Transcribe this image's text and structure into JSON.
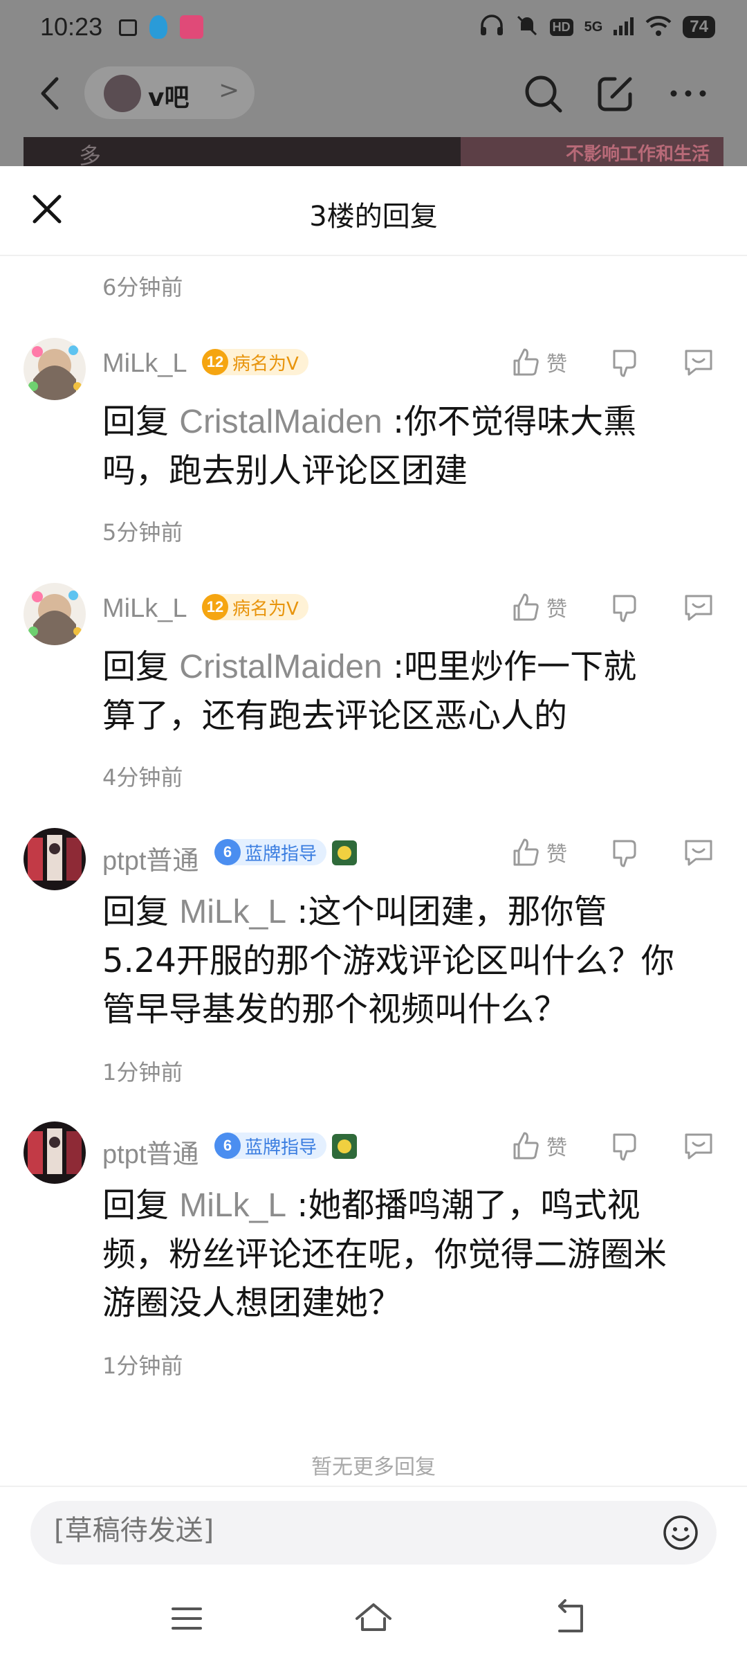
{
  "status_bar": {
    "time": "10:23",
    "network": "5G",
    "battery": "74"
  },
  "top_nav": {
    "forum_name": "v吧",
    "forum_arrow": ">"
  },
  "background_strip": {
    "left_text": "多",
    "right_text": "不影响工作和生活"
  },
  "sheet": {
    "title": "3楼的回复",
    "first_time": "6分钟前",
    "no_more": "暂无更多回复"
  },
  "replies": [
    {
      "username": "MiLk_L",
      "level": "12",
      "badge": "病名为V",
      "like_label": "赞",
      "prefix": "回复",
      "target": "CristalMaiden",
      "text_lines": [
        ":你不觉得味大熏",
        "吗，跑去别人评论区团建"
      ],
      "time": "5分钟前"
    },
    {
      "username": "MiLk_L",
      "level": "12",
      "badge": "病名为V",
      "like_label": "赞",
      "prefix": "回复",
      "target": "CristalMaiden",
      "text_lines": [
        ":吧里炒作一下就",
        "算了，还有跑去评论区恶心人的"
      ],
      "time": "4分钟前"
    },
    {
      "username": "ptpt普通",
      "level": "6",
      "badge": "蓝牌指导",
      "like_label": "赞",
      "prefix": "回复",
      "target": "MiLk_L",
      "text_lines": [
        ":这个叫团建，那你管",
        "5.24开服的那个游戏评论区叫什么？你",
        "管早导基发的那个视频叫什么？"
      ],
      "time": "1分钟前"
    },
    {
      "username": "ptpt普通",
      "level": "6",
      "badge": "蓝牌指导",
      "like_label": "赞",
      "prefix": "回复",
      "target": "MiLk_L",
      "text_lines": [
        ":她都播鸣潮了，鸣式视",
        "频，粉丝评论还在呢，你觉得二游圈米",
        "游圈没人想团建她？"
      ],
      "time": "1分钟前"
    }
  ],
  "input": {
    "placeholder": "[草稿待发送]"
  },
  "icons": {
    "back": "back-arrow-icon",
    "search": "search-icon",
    "compose": "compose-icon",
    "more": "more-dots-icon",
    "close": "close-icon",
    "like": "thumbs-up-icon",
    "dislike": "thumbs-down-icon",
    "comment": "comment-bubble-icon",
    "emoji": "emoji-icon"
  },
  "colors": {
    "accent_blue": "#4b8ef0",
    "badge_orange": "#f5a511",
    "muted_text": "#8c8c8c"
  }
}
